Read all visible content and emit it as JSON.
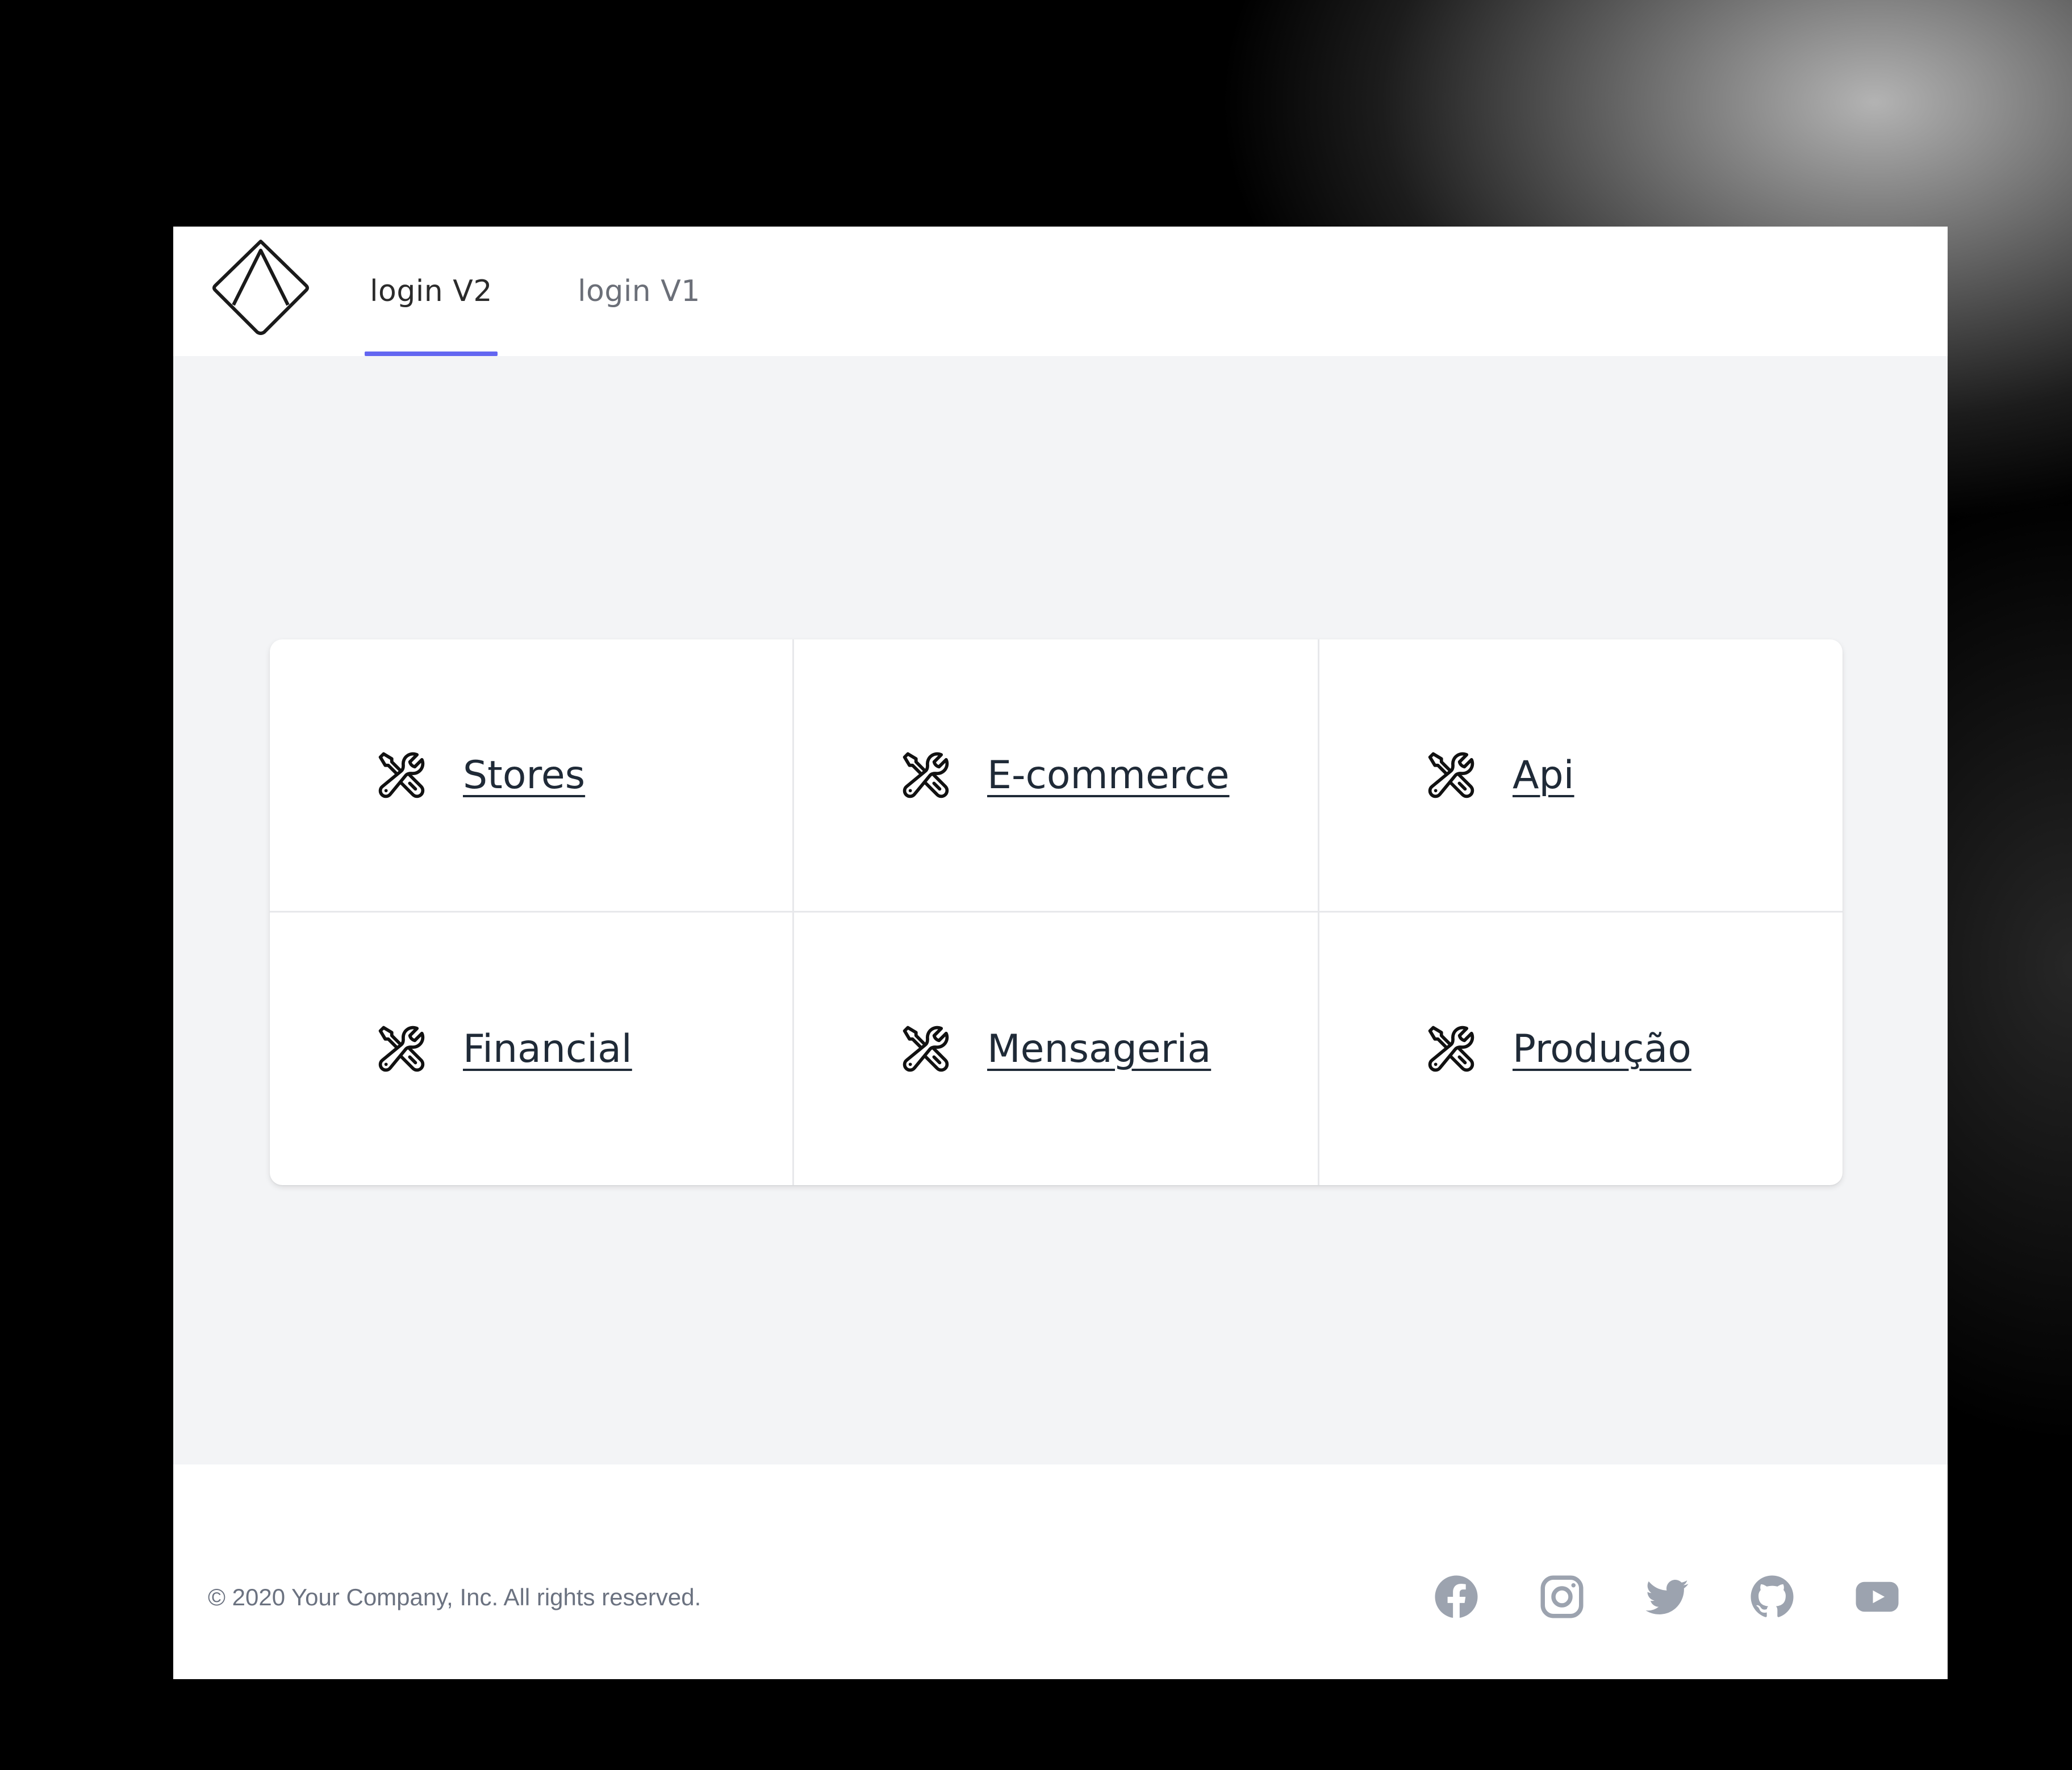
{
  "nav": {
    "tabs": [
      {
        "label": "login V2",
        "active": true
      },
      {
        "label": "login V1",
        "active": false
      }
    ],
    "accent_color": "#6366f1"
  },
  "apps": [
    {
      "label": "Stores",
      "icon": "tools-icon"
    },
    {
      "label": "E-commerce",
      "icon": "tools-icon"
    },
    {
      "label": "Api",
      "icon": "tools-icon"
    },
    {
      "label": "Financial",
      "icon": "tools-icon"
    },
    {
      "label": "Mensageria",
      "icon": "tools-icon"
    },
    {
      "label": "Produção",
      "icon": "tools-icon"
    }
  ],
  "footer": {
    "copyright": "© 2020 Your Company, Inc. All rights reserved.",
    "social": [
      "facebook-icon",
      "instagram-icon",
      "twitter-icon",
      "github-icon",
      "youtube-icon"
    ]
  }
}
